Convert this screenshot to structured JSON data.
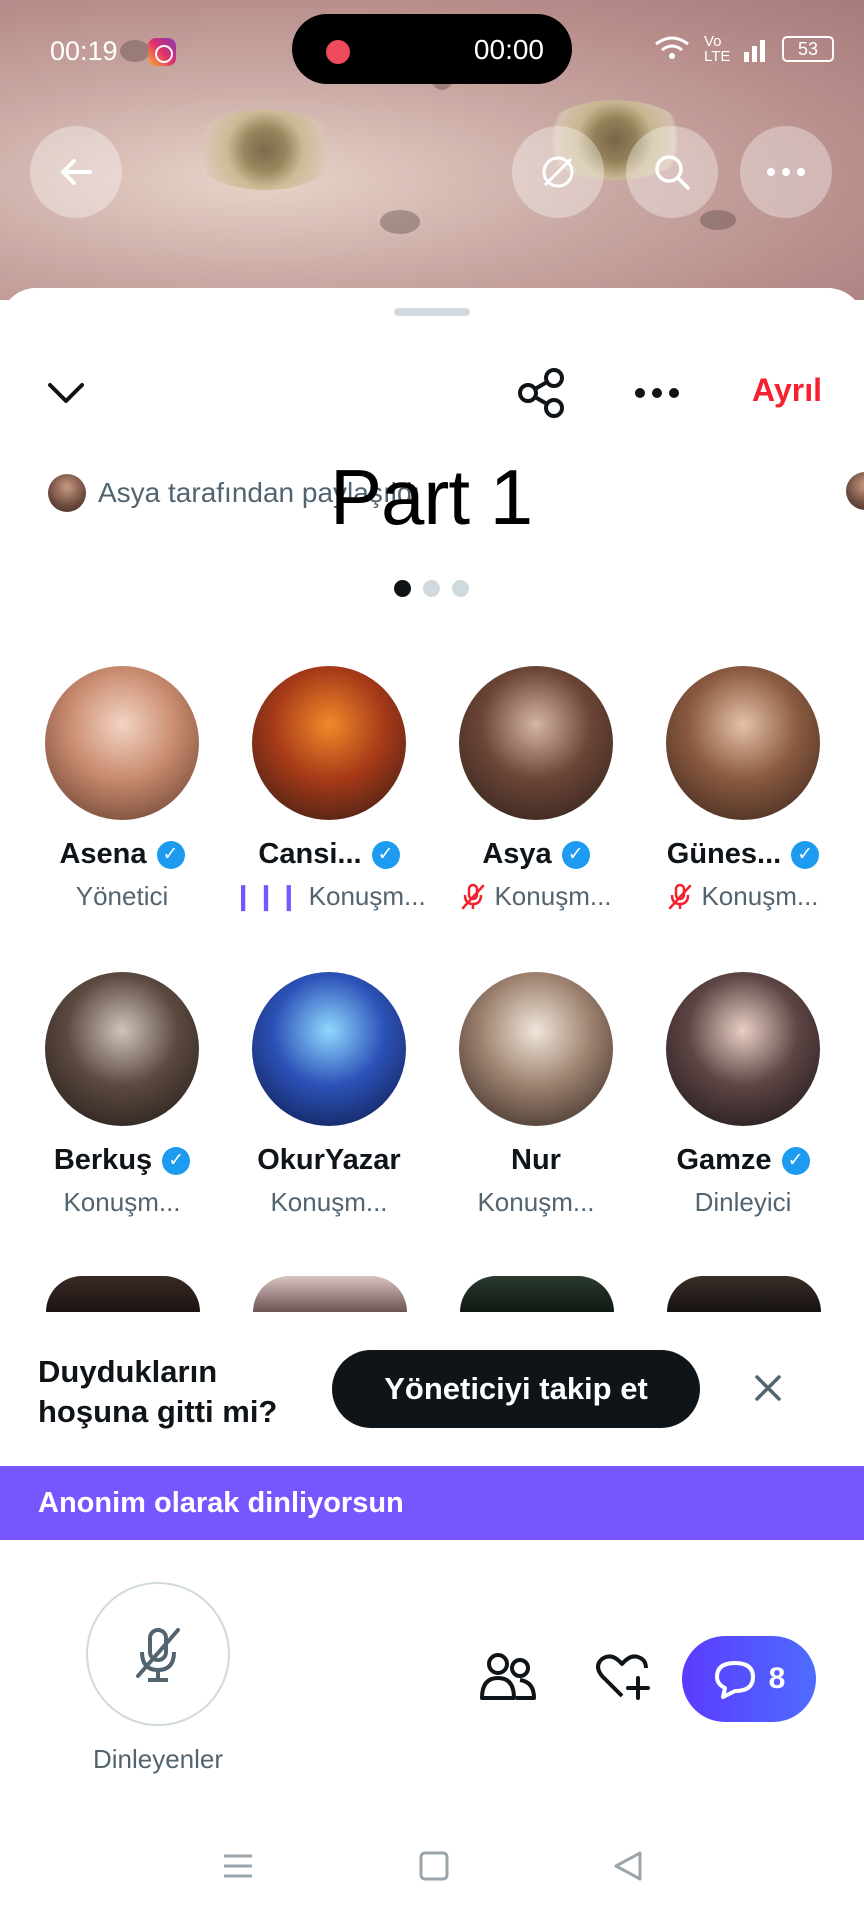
{
  "status_bar": {
    "time": "00:19",
    "recording_time": "00:00",
    "network": "Vo LTE",
    "battery": "53"
  },
  "header_actions": {
    "back_icon": "arrow-left-icon",
    "pip_icon": "link-slash-icon",
    "search_icon": "search-icon",
    "more_icon": "more-horizontal-icon"
  },
  "toolbar": {
    "collapse_icon": "chevron-down-icon",
    "share_icon": "share-icon",
    "more_icon": "more-horizontal-icon",
    "leave_label": "Ayrıl"
  },
  "space": {
    "host_line": "Asya tarafından paylaşıldı",
    "overlay_title": "Part 1",
    "page_dots": 3,
    "active_dot": 0
  },
  "participants": [
    {
      "name": "Asena",
      "verified": true,
      "role": "Yönetici",
      "indicator": "none",
      "avatar_colors": [
        "#f4d4c4",
        "#c88a6e",
        "#5a3628"
      ]
    },
    {
      "name": "Cansi...",
      "verified": true,
      "role": "Konuşm...",
      "indicator": "speaking",
      "avatar_colors": [
        "#f08a2a",
        "#a83a18",
        "#2b1a14"
      ]
    },
    {
      "name": "Asya",
      "verified": true,
      "role": "Konuşm...",
      "indicator": "muted",
      "avatar_colors": [
        "#d4b6a2",
        "#6b4536",
        "#2b1e1a"
      ]
    },
    {
      "name": "Günes...",
      "verified": true,
      "role": "Konuşm...",
      "indicator": "muted",
      "avatar_colors": [
        "#e4c1a6",
        "#8b5a40",
        "#33221b"
      ]
    },
    {
      "name": "Berkuş",
      "verified": true,
      "role": "Konuşm...",
      "indicator": "none",
      "avatar_colors": [
        "#cfc4bb",
        "#5c4a40",
        "#1c1715"
      ]
    },
    {
      "name": "OkurYazar",
      "verified": false,
      "role": "Konuşm...",
      "indicator": "none",
      "avatar_colors": [
        "#8fd8ff",
        "#2c52b8",
        "#0b1540"
      ]
    },
    {
      "name": "Nur",
      "verified": false,
      "role": "Konuşm...",
      "indicator": "none",
      "avatar_colors": [
        "#efe6da",
        "#9e8270",
        "#2a201b"
      ]
    },
    {
      "name": "Gamze",
      "verified": true,
      "role": "Dinleyici",
      "indicator": "none",
      "avatar_colors": [
        "#e8cfc4",
        "#5e4545",
        "#161112"
      ]
    }
  ],
  "follow_prompt": {
    "question_line1": "Duydukların",
    "question_line2": "hoşuna gitti mi?",
    "button_label": "Yöneticiyi takip et",
    "close_icon": "close-icon"
  },
  "anon_banner": "Anonim olarak dinliyorsun",
  "bottom_bar": {
    "mic_label": "Dinleyenler",
    "mic_icon": "mic-off-icon",
    "people_icon": "people-icon",
    "heart_icon": "heart-plus-icon",
    "chat_icon": "chat-icon",
    "chat_count": "8"
  },
  "colors": {
    "accent_purple": "#7856ff",
    "leave_red": "#f4212e",
    "verified_blue": "#1d9bf0",
    "chat_blue": "#4e5cff"
  }
}
